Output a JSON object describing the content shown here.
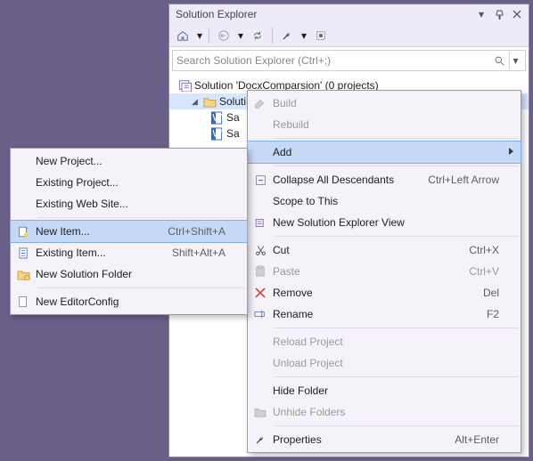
{
  "panel": {
    "title": "Solution Explorer",
    "search_placeholder": "Search Solution Explorer (Ctrl+;)"
  },
  "tree": {
    "root": "Solution 'DocxComparsion' (0 projects)",
    "folder": "Soluti",
    "file_a": "Sa",
    "file_b": "Sa"
  },
  "menu1": {
    "build": "Build",
    "rebuild": "Rebuild",
    "add": "Add",
    "collapse": "Collapse All Descendants",
    "collapse_sc": "Ctrl+Left Arrow",
    "scope": "Scope to This",
    "newview": "New Solution Explorer View",
    "cut": "Cut",
    "cut_sc": "Ctrl+X",
    "paste": "Paste",
    "paste_sc": "Ctrl+V",
    "remove": "Remove",
    "remove_sc": "Del",
    "rename": "Rename",
    "rename_sc": "F2",
    "reload": "Reload Project",
    "unload": "Unload Project",
    "hide": "Hide Folder",
    "unhide": "Unhide Folders",
    "props": "Properties",
    "props_sc": "Alt+Enter"
  },
  "menu2": {
    "newproj": "New Project...",
    "exproj": "Existing Project...",
    "exweb": "Existing Web Site...",
    "newitem": "New Item...",
    "newitem_sc": "Ctrl+Shift+A",
    "exitem": "Existing Item...",
    "exitem_sc": "Shift+Alt+A",
    "newsf": "New Solution Folder",
    "newec": "New EditorConfig"
  }
}
